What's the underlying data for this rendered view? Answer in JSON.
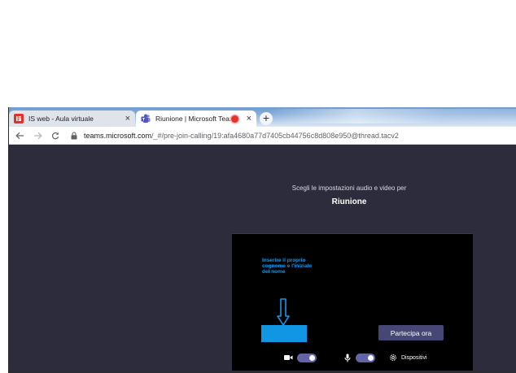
{
  "browser": {
    "tabs": [
      {
        "title": "IS web - Aula virtuale",
        "active": false,
        "icon": "is-web-favicon"
      },
      {
        "title": "Riunione | Microsoft Teams",
        "active": true,
        "icon": "teams-favicon",
        "recording": true
      }
    ],
    "new_tab_label": "+",
    "close_label": "×",
    "url_host": "teams.microsoft.com",
    "url_path": "/_#/pre-join-calling/19:afa4680a77d7405cb44756c8d808e950@thread.tacv2"
  },
  "teams": {
    "prompt": "Scegli le impostazioni audio e video per",
    "meeting_title": "Riunione",
    "annotation": "Inserire il proprio cognome e l'iniziale del nome",
    "name_input_value": "",
    "join_label": "Partecipa ora",
    "camera_on": true,
    "mic_on": true,
    "devices_label": "Dispositivi"
  },
  "colors": {
    "page_bg": "#2d2c3c",
    "accent": "#6264a7",
    "join_button": "#464775",
    "annotation": "#1796e8",
    "name_box": "#1096e3"
  }
}
